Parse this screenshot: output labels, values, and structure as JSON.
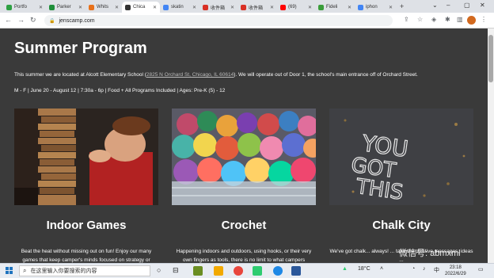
{
  "browser": {
    "tabs": [
      {
        "title": "Portfo",
        "color": "#2ea043"
      },
      {
        "title": "Parker",
        "color": "#1f8f3a"
      },
      {
        "title": "Whits",
        "color": "#e8711a"
      },
      {
        "title": "Chica",
        "color": "#333333",
        "active": true
      },
      {
        "title": "skatin",
        "color": "#4285f4"
      },
      {
        "title": "收件箱",
        "color": "#d93025"
      },
      {
        "title": "收件箱",
        "color": "#d93025"
      },
      {
        "title": "(69)",
        "color": "#ff0000"
      },
      {
        "title": "Fideli",
        "color": "#3a9d3a"
      },
      {
        "title": "iphon",
        "color": "#4285f4"
      }
    ],
    "url": "jenscamp.com"
  },
  "page": {
    "title": "Summer Program",
    "intro_before": "This summer we are located at Alcott Elementary School (",
    "address_link": "2825 N Orchard St, Chicago, IL 60614",
    "intro_after": ").   We will operate out of Door 1, the school's main entrance off of Orchard Street.",
    "details": "M - F | June 20 - August 12 | 7:30a - 6p | Food + All Programs Included | Ages: Pre-K (5) - 12",
    "cards": [
      {
        "title": "Indoor Games",
        "text": "Beat the heat without missing out on fun!  Enjoy our many games that keep camper's minds focused on strategy or",
        "image": "jenga-blocks-photo"
      },
      {
        "title": "Crochet",
        "text": "Happening indoors and outdoors, using hooks, or their very own fingers as tools, there is no limit to what campers",
        "image": "yarn-basket-photo"
      },
      {
        "title": "Chalk City",
        "text": "We've got chalk... always! ... take the positive messages, ideas ...",
        "image": "chalk-you-got-this-photo",
        "chalk_text": "YOU GOT THIS"
      }
    ]
  },
  "taskbar": {
    "search_placeholder": "在这里输入你要搜索的内容",
    "weather": "18°C",
    "time": "23:18",
    "date": "2022/6/29"
  },
  "watermark": "微信号: abmxml"
}
